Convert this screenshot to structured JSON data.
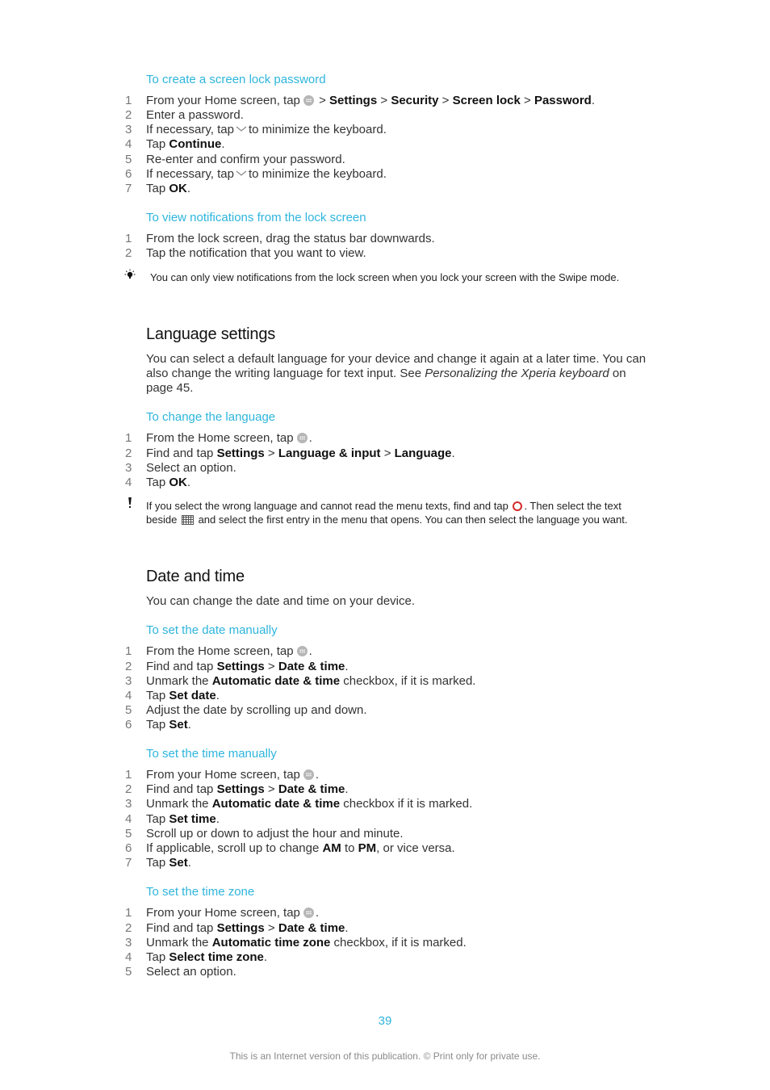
{
  "sections": {
    "lock_password": {
      "title": "To create a screen lock password",
      "steps": [
        {
          "num": "1",
          "pre": "From your Home screen, tap",
          "icon": "apps-icon",
          "s1": " > ",
          "b1": "Settings",
          "s2": " > ",
          "b2": "Security",
          "s3": " > ",
          "b3": "Screen lock",
          "s4": " > ",
          "b4": "Password",
          "post": "."
        },
        {
          "num": "2",
          "text": "Enter a password."
        },
        {
          "num": "3",
          "pre": "If necessary, tap",
          "icon": "chevron-down-icon",
          "post": "to minimize the keyboard."
        },
        {
          "num": "4",
          "pre": "Tap ",
          "b1": "Continue",
          "post": "."
        },
        {
          "num": "5",
          "text": "Re-enter and confirm your password."
        },
        {
          "num": "6",
          "pre": "If necessary, tap",
          "icon": "chevron-down-icon",
          "post": "to minimize the keyboard."
        },
        {
          "num": "7",
          "pre": "Tap ",
          "b1": "OK",
          "post": "."
        }
      ]
    },
    "view_notifications": {
      "title": "To view notifications from the lock screen",
      "steps": [
        {
          "num": "1",
          "text": "From the lock screen, drag the status bar downwards."
        },
        {
          "num": "2",
          "text": "Tap the notification that you want to view."
        }
      ],
      "tip": "You can only view notifications from the lock screen when you lock your screen with the Swipe mode."
    },
    "language": {
      "heading": "Language settings",
      "intro_1": "You can select a default language for your device and change it again at a later time. You can also change the writing language for text input. See ",
      "intro_link": "Personalizing the Xperia keyboard",
      "intro_2": " on page 45.",
      "procedure_title": "To change the language",
      "steps": [
        {
          "num": "1",
          "pre": "From the Home screen, tap",
          "icon": "apps-icon",
          "post": "."
        },
        {
          "num": "2",
          "pre": "Find and tap ",
          "b1": "Settings",
          "s1": " > ",
          "b2": "Language & input",
          "s2": " > ",
          "b3": "Language",
          "post": "."
        },
        {
          "num": "3",
          "text": "Select an option."
        },
        {
          "num": "4",
          "pre": "Tap ",
          "b1": "OK",
          "post": "."
        }
      ],
      "warning_1": "If you select the wrong language and cannot read the menu texts, find and tap",
      "warning_2": ". Then select the text beside",
      "warning_3": "and select the first entry in the menu that opens. You can then select the language you want."
    },
    "date_time": {
      "heading": "Date and time",
      "intro": "You can change the date and time on your device.",
      "date_title": "To set the date manually",
      "date_steps": [
        {
          "num": "1",
          "pre": "From the Home screen, tap",
          "icon": "apps-icon",
          "post": "."
        },
        {
          "num": "2",
          "pre": "Find and tap ",
          "b1": "Settings",
          "s1": " > ",
          "b2": "Date & time",
          "post": "."
        },
        {
          "num": "3",
          "pre": "Unmark the ",
          "b1": "Automatic date & time",
          "post": " checkbox, if it is marked."
        },
        {
          "num": "4",
          "pre": "Tap ",
          "b1": "Set date",
          "post": "."
        },
        {
          "num": "5",
          "text": "Adjust the date by scrolling up and down."
        },
        {
          "num": "6",
          "pre": "Tap ",
          "b1": "Set",
          "post": "."
        }
      ],
      "time_title": "To set the time manually",
      "time_steps": [
        {
          "num": "1",
          "pre": "From your Home screen, tap",
          "icon": "apps-icon",
          "post": "."
        },
        {
          "num": "2",
          "pre": "Find and tap ",
          "b1": "Settings",
          "s1": " > ",
          "b2": "Date & time",
          "post": "."
        },
        {
          "num": "3",
          "pre": "Unmark the ",
          "b1": "Automatic date & time",
          "post": " checkbox if it is marked."
        },
        {
          "num": "4",
          "pre": "Tap ",
          "b1": "Set time",
          "post": "."
        },
        {
          "num": "5",
          "text": "Scroll up or down to adjust the hour and minute."
        },
        {
          "num": "6",
          "pre": "If applicable, scroll up to change ",
          "b1": "AM",
          "s1": " to ",
          "b2": "PM",
          "post": ", or vice versa."
        },
        {
          "num": "7",
          "pre": "Tap ",
          "b1": "Set",
          "post": "."
        }
      ],
      "zone_title": "To set the time zone",
      "zone_steps": [
        {
          "num": "1",
          "pre": "From your Home screen, tap",
          "icon": "apps-icon",
          "post": "."
        },
        {
          "num": "2",
          "pre": "Find and tap ",
          "b1": "Settings",
          "s1": " > ",
          "b2": "Date & time",
          "post": "."
        },
        {
          "num": "3",
          "pre": "Unmark the ",
          "b1": "Automatic time zone",
          "post": " checkbox, if it is marked."
        },
        {
          "num": "4",
          "pre": "Tap ",
          "b1": "Select time zone",
          "post": "."
        },
        {
          "num": "5",
          "text": "Select an option."
        }
      ]
    }
  },
  "footer": {
    "page_number": "39",
    "notice": "This is an Internet version of this publication. © Print only for private use."
  },
  "colors": {
    "accent": "#2eb5dc",
    "body_text": "#333333",
    "home_icon_red": "#d42a2a"
  }
}
